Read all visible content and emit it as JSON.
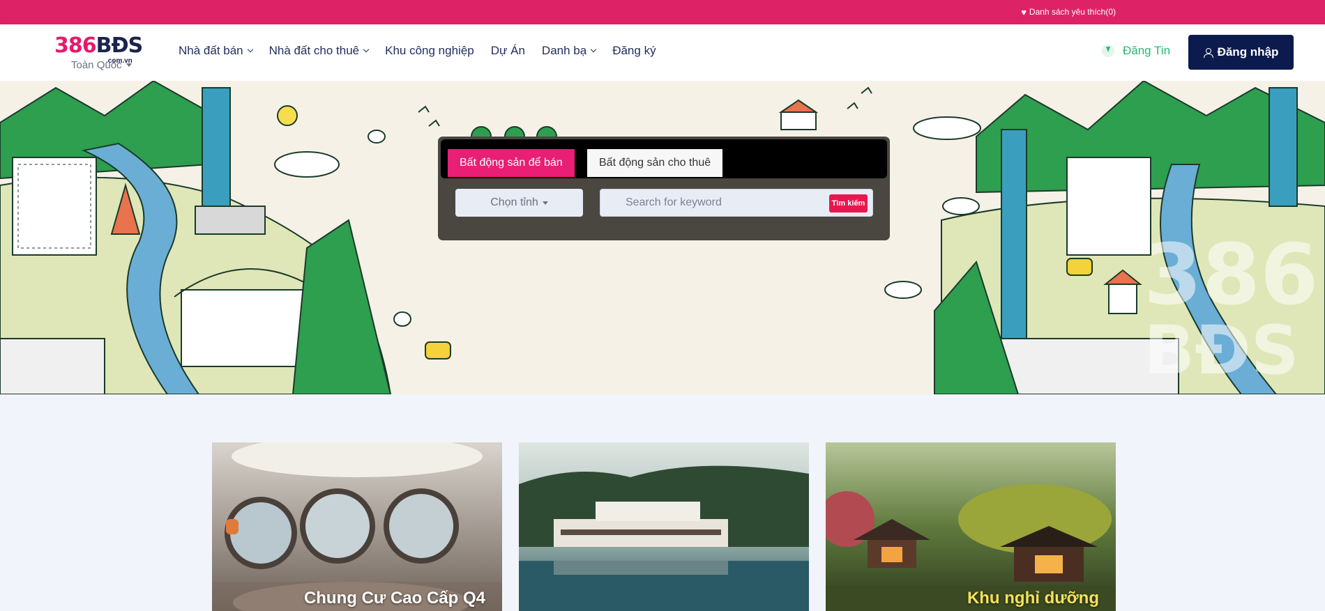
{
  "topbar": {
    "wishlist_label": "Danh sách yêu thích(0)"
  },
  "logo": {
    "brand_number": "386",
    "brand_letters": "BĐS",
    "domain": ".com.vn"
  },
  "region": {
    "selected": "Toàn Quốc"
  },
  "nav": {
    "items": [
      {
        "label": "Nhà đất bán",
        "has_dropdown": true
      },
      {
        "label": "Nhà đất cho thuê",
        "has_dropdown": true
      },
      {
        "label": "Khu công nghiệp",
        "has_dropdown": false
      },
      {
        "label": "Dự Án",
        "has_dropdown": false
      },
      {
        "label": "Danh bạ",
        "has_dropdown": true
      },
      {
        "label": "Đăng ký",
        "has_dropdown": false
      }
    ]
  },
  "header": {
    "post_label": "Đăng Tin",
    "login_label": "Đăng nhập"
  },
  "search": {
    "tabs": [
      {
        "label": "Bất động sản để bán",
        "active": true
      },
      {
        "label": "Bất động sản cho thuê",
        "active": false
      }
    ],
    "province_label": "Chọn tỉnh",
    "keyword_placeholder": "Search for keyword",
    "button_label": "Tìm kiếm"
  },
  "cards": [
    {
      "title": "Chung Cư Cao Cấp Q4"
    },
    {
      "title": ""
    },
    {
      "title": "Khu nghỉ dưỡng"
    }
  ],
  "colors": {
    "topbar": "#dd2366",
    "brand_pink": "#e6196c",
    "brand_navy": "#0c1b4d",
    "post_green": "#2bb673",
    "tab_active": "#e91e75"
  }
}
